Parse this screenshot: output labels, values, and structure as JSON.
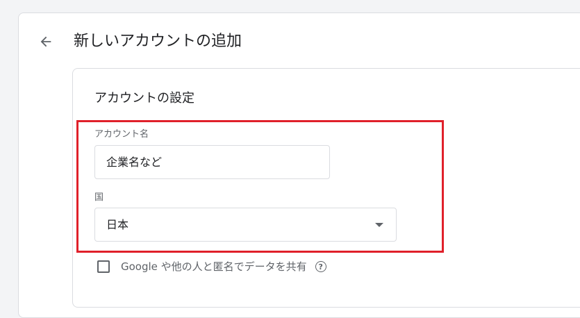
{
  "header": {
    "title": "新しいアカウントの追加",
    "back_icon": "arrow-left-icon"
  },
  "account_settings": {
    "title": "アカウントの設定",
    "account_name": {
      "label": "アカウント名",
      "placeholder": "企業名など",
      "value": ""
    },
    "country": {
      "label": "国",
      "selected": "日本"
    },
    "share_checkbox": {
      "label": "Google や他の人と匿名でデータを共有",
      "checked": false,
      "help_icon": "help-circle-icon"
    }
  },
  "colors": {
    "highlight": "#e0202a",
    "border": "#dadce0",
    "text": "#202124",
    "muted": "#5f6368",
    "background": "#f3f4f6"
  }
}
